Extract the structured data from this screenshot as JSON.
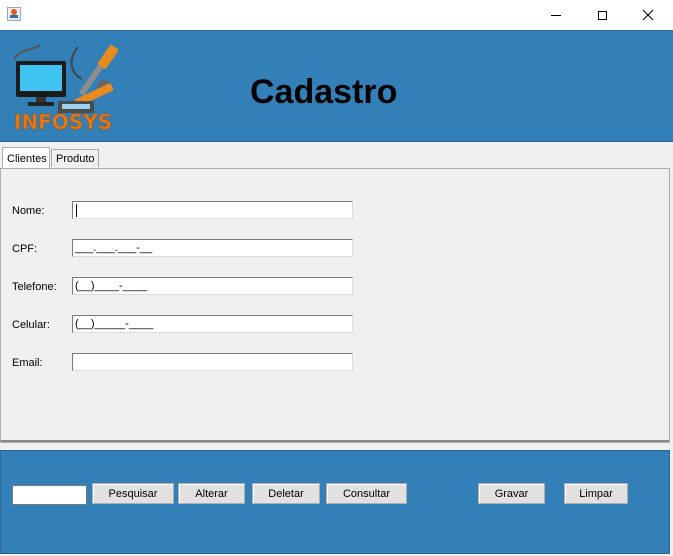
{
  "window": {
    "icons": {
      "app": "java-cup-icon",
      "minimize": "minimize-icon",
      "maximize": "maximize-icon",
      "close": "close-icon"
    }
  },
  "header": {
    "title": "Cadastro",
    "logo_text": "INFOSYS",
    "background": "#3380b8"
  },
  "tabs": [
    {
      "label": "Clientes",
      "active": true
    },
    {
      "label": "Produto",
      "active": false
    }
  ],
  "form": {
    "nome": {
      "label": "Nome:",
      "value": ""
    },
    "cpf": {
      "label": "CPF:",
      "value": "___.___.___-__"
    },
    "telefone": {
      "label": "Telefone:",
      "value": "(__)____-____"
    },
    "celular": {
      "label": "Celular:",
      "value": "(__)_____-____"
    },
    "email": {
      "label": "Email:",
      "value": ""
    }
  },
  "actions": {
    "search_value": "",
    "pesquisar": "Pesquisar",
    "alterar": "Alterar",
    "deletar": "Deletar",
    "consultar": "Consultar",
    "gravar": "Gravar",
    "limpar": "Limpar"
  }
}
